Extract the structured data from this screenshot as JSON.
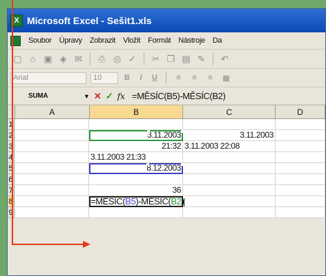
{
  "window": {
    "title": "Microsoft Excel - Sešit1.xls",
    "app_icon": "X"
  },
  "menu": {
    "items": [
      "Soubor",
      "Úpravy",
      "Zobrazit",
      "Vložit",
      "Formát",
      "Nástroje",
      "Da"
    ]
  },
  "toolbar": {
    "icons": [
      "new-icon",
      "open-icon",
      "save-icon",
      "permission-icon",
      "email-icon",
      "print-icon",
      "print-preview-icon",
      "spelling-icon",
      "cut-icon",
      "copy-icon",
      "paste-icon",
      "format-painter-icon",
      "undo-icon"
    ]
  },
  "format_toolbar": {
    "font": "Arial",
    "size": "10",
    "buttons": [
      "B",
      "I",
      "U"
    ]
  },
  "formula_bar": {
    "name_box": "SUMA",
    "cancel_symbol": "✕",
    "enter_symbol": "✓",
    "fx_symbol": "fx",
    "formula": "=MĚSÍC(B5)-MĚSÍC(B2)"
  },
  "sheet": {
    "columns": [
      "A",
      "B",
      "C",
      "D"
    ],
    "rows": [
      "1",
      "2",
      "3",
      "4",
      "5",
      "6",
      "7",
      "8",
      "9"
    ],
    "cells": {
      "B2": "3.11.2003",
      "C2": "3.11.2003",
      "B3": "21:32",
      "C3": "3.11.2003 22:08",
      "B4": "3.11.2003 21:33",
      "B5": "8.12.2003",
      "B7": "36"
    },
    "editing_cell": {
      "address": "B8",
      "prefix": "=MĚSÍC(",
      "ref1": "B5",
      "middle": ")-MĚSÍC(",
      "ref2": "B2",
      "suffix": ")"
    }
  },
  "colors": {
    "background": "#6fa86b",
    "arrow": "#e23b1a",
    "ref_b5": "#4444d0",
    "ref_b2": "#2e9a3c"
  }
}
